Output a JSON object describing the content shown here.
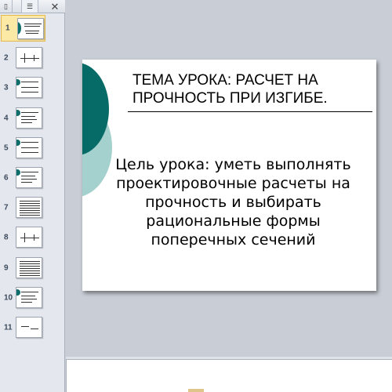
{
  "panel": {
    "tab_slides_icon": "slides-tab-icon",
    "tab_outline_icon": "outline-tab-icon",
    "close_glyph": "✕",
    "slides": [
      {
        "number": "1",
        "active": true
      },
      {
        "number": "2"
      },
      {
        "number": "3"
      },
      {
        "number": "4"
      },
      {
        "number": "5"
      },
      {
        "number": "6"
      },
      {
        "number": "7"
      },
      {
        "number": "8"
      },
      {
        "number": "9"
      },
      {
        "number": "10"
      },
      {
        "number": "11"
      }
    ]
  },
  "slide": {
    "title": "ТЕМА УРОКА: РАСЧЕТ НА ПРОЧНОСТЬ ПРИ ИЗГИБЕ.",
    "body": "Цель урока: уметь выполнять проектировочные расчеты на прочность и выбирать рациональные формы поперечных сечений",
    "accent_dark": "#066b67",
    "accent_light": "#a4d0cd"
  },
  "notes": {
    "placeholder": ""
  }
}
